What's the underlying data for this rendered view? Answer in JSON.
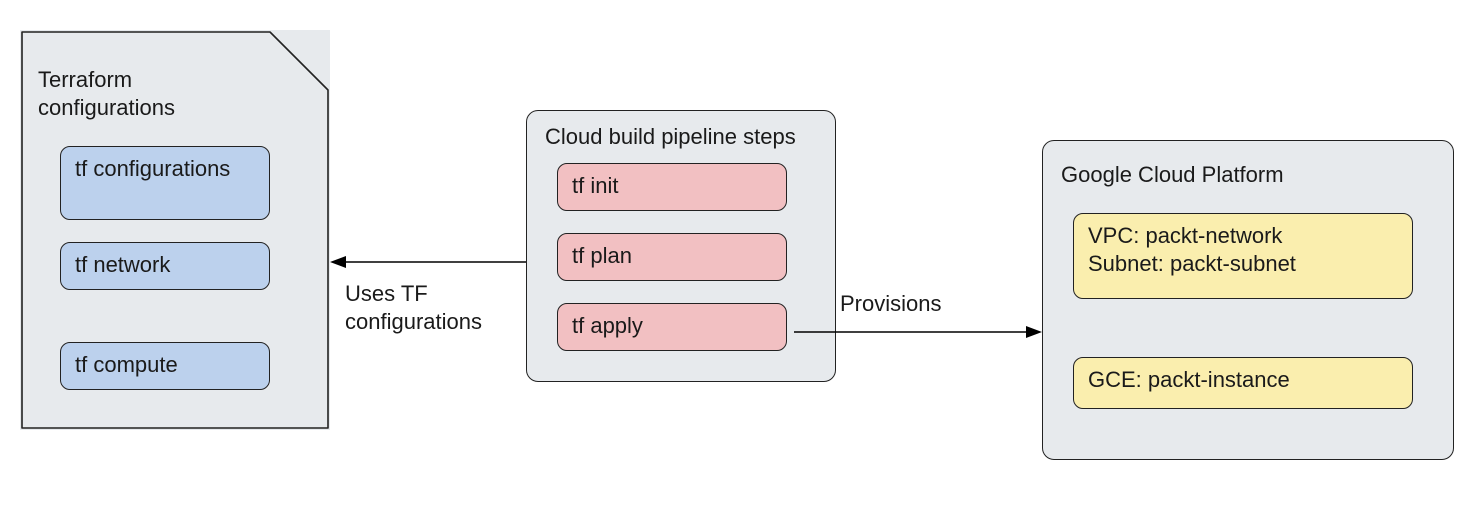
{
  "terraform": {
    "title": "Terraform\nconfigurations",
    "items": [
      "tf configurations",
      "tf network",
      "tf compute"
    ]
  },
  "pipeline": {
    "title": "Cloud build pipeline steps",
    "steps": [
      "tf init",
      "tf plan",
      "tf apply"
    ]
  },
  "gcp": {
    "title": "Google Cloud Platform",
    "resources": [
      "VPC: packt-network\nSubnet: packt-subnet",
      "GCE: packt-instance"
    ]
  },
  "arrow_uses": {
    "label": "Uses TF\nconfigurations"
  },
  "arrow_provisions": {
    "label": "Provisions"
  }
}
